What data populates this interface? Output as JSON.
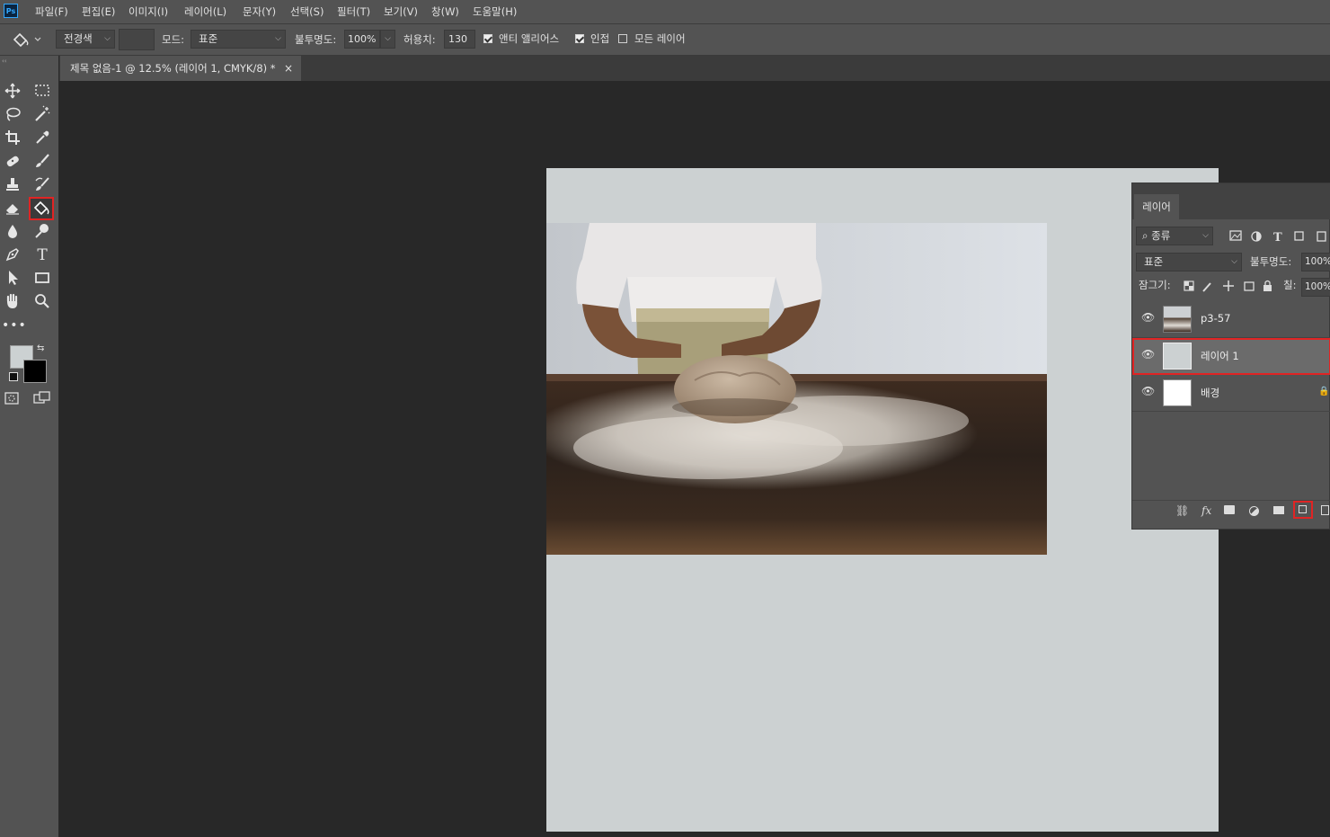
{
  "app": {
    "logo": "Ps"
  },
  "menu": [
    "파일(F)",
    "편집(E)",
    "이미지(I)",
    "레이어(L)",
    "문자(Y)",
    "선택(S)",
    "필터(T)",
    "보기(V)",
    "창(W)",
    "도움말(H)"
  ],
  "options": {
    "tool_icon": "paint-bucket-icon",
    "fill_source": "전경색",
    "mode_label": "모드:",
    "mode_value": "표준",
    "opacity_label": "불투명도:",
    "opacity_value": "100%",
    "tolerance_label": "허용치:",
    "tolerance_value": "130",
    "antialias_label": "앤티 앨리어스",
    "antialias_checked": true,
    "contiguous_label": "인접",
    "contiguous_checked": true,
    "all_layers_label": "모든 레이어",
    "all_layers_checked": false
  },
  "document": {
    "tab_title": "제목 없음-1 @ 12.5% (레이어 1, CMYK/8) *",
    "close_glyph": "×",
    "canvas_color": "#ccd1d2"
  },
  "toolbar": {
    "tools": [
      "move-icon",
      "marquee-icon",
      "lasso-icon",
      "magic-wand-icon",
      "crop-icon",
      "eyedropper-icon",
      "healing-brush-icon",
      "brush-icon",
      "clone-stamp-icon",
      "history-brush-icon",
      "eraser-icon",
      "paint-bucket-icon",
      "blur-icon",
      "dodge-icon",
      "pen-icon",
      "type-icon",
      "path-selection-icon",
      "rectangle-icon",
      "hand-icon",
      "zoom-icon",
      "more-tools-icon"
    ],
    "selected_tool": "paint-bucket-icon",
    "foreground_color": "#ccd1d2",
    "background_color": "#000000"
  },
  "layers_panel": {
    "tab_label": "레이어",
    "filter_label": "종류",
    "blend_mode": "표준",
    "opacity_label": "불투명도:",
    "opacity_value": "100%",
    "lock_label": "잠그기:",
    "fill_label": "칠:",
    "fill_value": "100%",
    "layers": [
      {
        "name": "p3-57",
        "visible": true,
        "locked": false,
        "selected": false
      },
      {
        "name": "레이어 1",
        "visible": true,
        "locked": false,
        "selected": true
      },
      {
        "name": "배경",
        "visible": true,
        "locked": true,
        "selected": false
      }
    ],
    "bottom_icons": [
      "link-icon",
      "fx-icon",
      "mask-icon",
      "adjustment-icon",
      "folder-icon",
      "new-layer-icon",
      "trash-icon"
    ],
    "highlighted_button": "new-layer-icon"
  },
  "colors": {
    "highlight": "#e02424",
    "ui_bg": "#535353",
    "workspace": "#282828"
  }
}
